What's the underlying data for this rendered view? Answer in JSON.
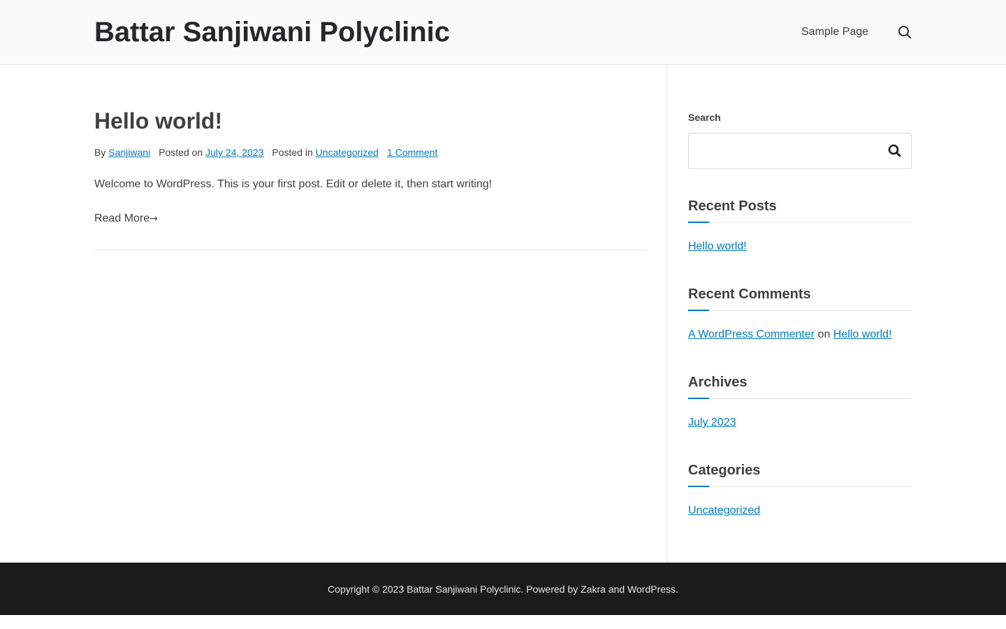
{
  "header": {
    "site_title": "Battar Sanjiwani Polyclinic",
    "nav": [
      {
        "label": "Sample Page"
      }
    ],
    "search_icon": "search-icon"
  },
  "post": {
    "title": "Hello world!",
    "meta": {
      "by_label": "By",
      "author": "Sanjiwani",
      "posted_on_label": "Posted on",
      "date": "July 24, 2023",
      "posted_in_label": "Posted in",
      "category": "Uncategorized",
      "comments": "1 Comment"
    },
    "excerpt": "Welcome to WordPress. This is your first post. Edit or delete it, then start writing!",
    "read_more": "Read More",
    "read_more_icon": "arrow-right-icon"
  },
  "sidebar": {
    "search": {
      "label": "Search",
      "value": "",
      "icon": "search-icon"
    },
    "recent_posts": {
      "title": "Recent Posts",
      "items": [
        "Hello world!"
      ]
    },
    "recent_comments": {
      "title": "Recent Comments",
      "items": [
        {
          "author": "A WordPress Commenter",
          "on": "on",
          "post": "Hello world!"
        }
      ]
    },
    "archives": {
      "title": "Archives",
      "items": [
        "July 2023"
      ]
    },
    "categories": {
      "title": "Categories",
      "items": [
        "Uncategorized"
      ]
    }
  },
  "footer": {
    "copyright_prefix": "Copyright © 2023",
    "site_name": "Battar Sanjiwani Polyclinic",
    "powered_by": ". Powered by",
    "theme": "Zakra",
    "and": "and",
    "cms": "WordPress",
    "end": "."
  },
  "colors": {
    "link": "#027abb",
    "header_bg": "#fafafa",
    "footer_bg": "#1b1b1b",
    "text": "#3f3f3f"
  }
}
